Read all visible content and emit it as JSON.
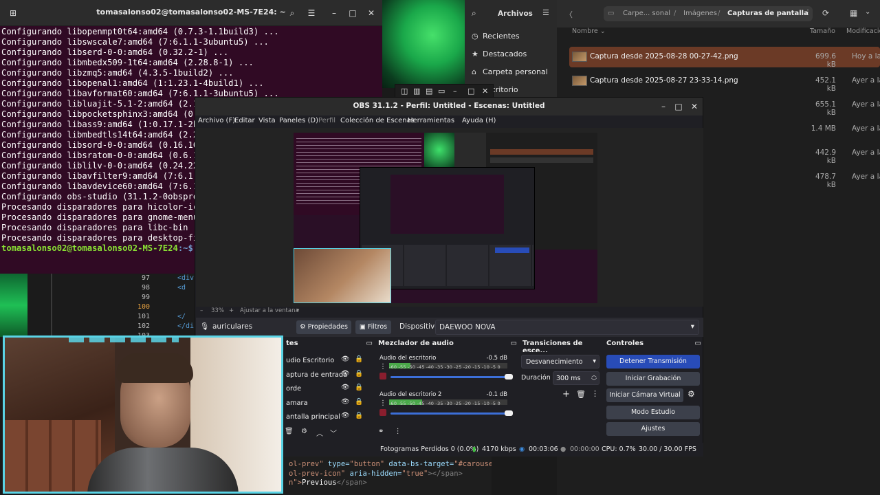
{
  "terminal": {
    "title": "tomasalonso02@tomasalonso02-MS-7E24: ~",
    "lines": [
      "Configurando libopenmpt0t64:amd64 (0.7.3-1.1build3) ...",
      "Configurando libswscale7:amd64 (7:6.1.1-3ubuntu5) ...",
      "Configurando libserd-0-0:amd64 (0.32.2-1) ...",
      "Configurando libmbedx509-1t64:amd64 (2.28.8-1) ...",
      "Configurando libzmq5:amd64 (4.3.5-1build2) ...",
      "Configurando libopenal1:amd64 (1:1.23.1-4build1) ...",
      "Configurando libavformat60:amd64 (7:6.1.1-3ubuntu5) ...",
      "Configurando libluajit-5.1-2:amd64 (2.1.0",
      "Configurando libpocketsphinx3:amd64 (0.8.",
      "Configurando libass9:amd64 (1:0.17.1-2bui",
      "Configurando libmbedtls14t64:amd64 (2.28.",
      "Configurando libsord-0-0:amd64 (0.16.16-2",
      "Configurando libsratom-0-0:amd64 (0.6.16-",
      "Configurando liblilv-0-0:amd64 (0.24.22-1",
      "Configurando libavfilter9:amd64 (7:6.1.1-",
      "Configurando libavdevice60:amd64 (7:6.1.1",
      "Configurando obs-studio (31.1.2-0obsproje",
      "Procesando disparadores para hicolor-icon",
      "Procesando disparadores para gnome-menus",
      "Procesando disparadores para libc-bin (2.",
      "Procesando disparadores para desktop-file"
    ],
    "prompt_user": "tomasalonso02@tomasalonso02-MS-7E24",
    "prompt_path": ":~$"
  },
  "files": {
    "sidebar_title": "Archivos",
    "sidebar_items": [
      "Recientes",
      "Destacados",
      "Carpeta personal",
      "Escritorio"
    ],
    "breadcrumb": [
      "Carpe... sonal",
      "Imágenes",
      "Capturas de pantalla"
    ],
    "col_name": "Nombre",
    "col_size": "Tamaño",
    "col_modified": "Modificación",
    "rows": [
      {
        "name": "Captura desde 2025-08-28 00-27-42.png",
        "size": "699.6 kB",
        "mod": "Hoy a las"
      },
      {
        "name": "Captura desde 2025-08-27 23-33-14.png",
        "size": "452.1 kB",
        "mod": "Ayer a las 2"
      },
      {
        "name": "png",
        "size": "655.1 kB",
        "mod": "Ayer a las 1"
      },
      {
        "name": "png",
        "size": "1.4 MB",
        "mod": "Ayer a las 1"
      },
      {
        "name": "png",
        "size": "442.9 kB",
        "mod": "Ayer a las 1"
      },
      {
        "name": "png",
        "size": "478.7 kB",
        "mod": "Ayer a las 1"
      }
    ]
  },
  "editor": {
    "line_numbers": [
      "97",
      "98",
      "99",
      "100",
      "101",
      "102",
      "103"
    ],
    "snippets": [
      "<div",
      "<d",
      "",
      "",
      "</",
      "</di",
      ""
    ],
    "bottom_lines": [
      [
        "ol-prev\" ",
        "type=",
        "\"button\" ",
        "data-bs-target=",
        "\"#carouselExamp"
      ],
      [
        "ol-prev-icon\" ",
        "aria-hidden=",
        "\"true\"",
        "></span>",
        ""
      ],
      [
        "n\">",
        "Previous",
        "</span>",
        "",
        ""
      ]
    ]
  },
  "obs": {
    "title": "OBS 31.1.2 - Perfil: Untitled - Escenas: Untitled",
    "menu": [
      "Archivo (F)",
      "Editar",
      "Vista",
      "Paneles (D)",
      "Perfil",
      "Colección de Escenas",
      "Herramientas",
      "Ayuda (H)"
    ],
    "zoom": "33%",
    "fit_label": "Ajustar a la ventana",
    "source_name": "auriculares",
    "properties_label": "Propiedades",
    "filters_label": "Filtros",
    "device_label": "Dispositivo",
    "device_value": "DAEWOO NOVA",
    "sources_title": "tes",
    "sources": [
      "udio Escritorio",
      "aptura de entrada",
      "orde",
      "amara",
      "antalla principal"
    ],
    "mixer_title": "Mezclador de audio",
    "mixer_channels": [
      {
        "name": "Audio del escritorio",
        "db": "-0.5 dB"
      },
      {
        "name": "Audio del escritorio 2",
        "db": "-0.1 dB"
      }
    ],
    "meter_ticks": "-60 -55 -50 -45 -40 -35 -30 -25 -20 -15 -10 -5 0",
    "transitions_title": "Transiciones de esce...",
    "transition_value": "Desvanecimiento",
    "duration_label": "Duración",
    "duration_value": "300 ms",
    "controls_title": "Controles",
    "controls": [
      "Detener Transmisión",
      "Iniciar Grabación",
      "Iniciar Cámara Virtual",
      "Modo Estudio",
      "Ajustes"
    ],
    "status": {
      "dropped": "Fotogramas Perdidos 0 (0.0%)",
      "bitrate": "4170 kbps",
      "stream_time": "00:03:06",
      "rec_time": "00:00:00",
      "cpu": "CPU: 0.7%",
      "fps": "30.00 / 30.00 FPS"
    }
  },
  "colors": {
    "terminal_bg": "#300a24",
    "accent_blue": "#284cb8",
    "webcam_border": "#5ad4e6",
    "selected_row": "#6b3a26"
  }
}
